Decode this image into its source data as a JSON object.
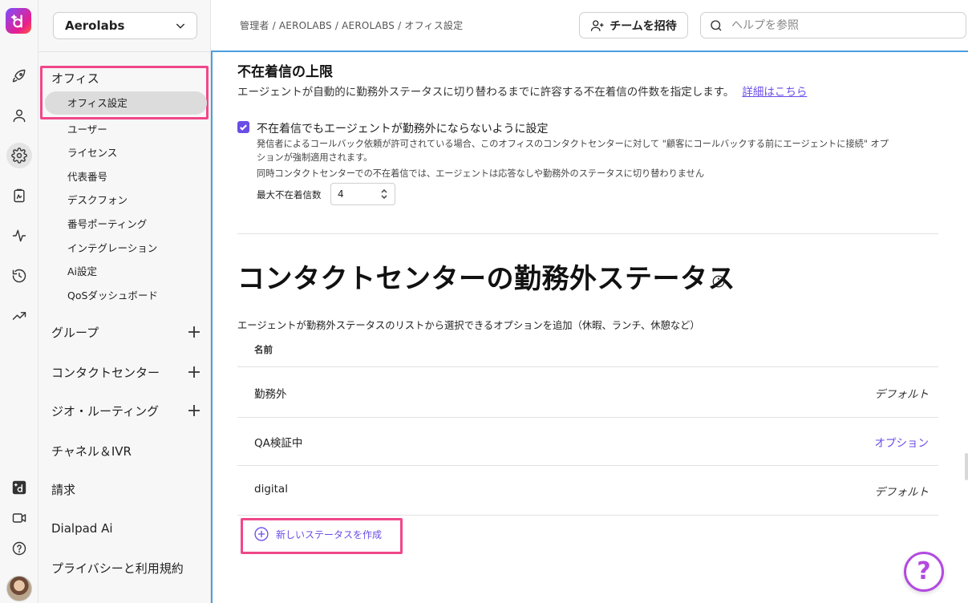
{
  "workspace": {
    "name": "Aerolabs"
  },
  "breadcrumb": "管理者 / AEROLABS / AEROLABS / オフィス設定",
  "topbar": {
    "invite_label": "チームを招待",
    "search_placeholder": "ヘルプを参照"
  },
  "sidebar": {
    "office_title": "オフィス",
    "office_items": [
      "オフィス設定",
      "ユーザー",
      "ライセンス",
      "代表番号",
      "デスクフォン",
      "番号ポーティング",
      "インテグレーション",
      "Ai設定",
      "QoSダッシュボード"
    ],
    "sections": [
      "グループ",
      "コンタクトセンター",
      "ジオ・ルーティング",
      "チャネル＆IVR",
      "請求",
      "Dialpad Ai",
      "プライバシーと利用規約"
    ]
  },
  "missed_calls": {
    "title": "不在着信の上限",
    "description": "エージェントが自動的に勤務外ステータスに切り替わるまでに許容する不在着信の件数を指定します。",
    "link": "詳細はこちら",
    "checkbox_label": "不在着信でもエージェントが勤務外にならないように設定",
    "checkbox_checked": true,
    "note_lines": [
      "発信者によるコールバック依頼が許可されている場合、このオフィスのコンタクトセンターに対して \"顧客にコールバックする前にエージェントに接続\" オプ",
      "ションが強制適用されます。",
      "同時コンタクトセンターでの不在着信では、エージェントは応答なしや勤務外のステータスに切り替わりません"
    ],
    "max_label": "最大不在着信数",
    "max_value": "4"
  },
  "status_section": {
    "title": "コンタクトセンターの勤務外ステータス",
    "description": "エージェントが勤務外ステータスのリストから選択できるオプションを追加（休暇、ランチ、休憩など）",
    "column_name": "名前",
    "rows": [
      {
        "name": "勤務外",
        "type": "デフォルト"
      },
      {
        "name": "QA検証中",
        "type": "オプション"
      },
      {
        "name": "digital",
        "type": "デフォルト"
      }
    ],
    "create_label": "新しいステータスを作成"
  },
  "icons": {
    "rail": [
      "rocket-icon",
      "person-icon",
      "gear-icon",
      "clipboard-icon",
      "activity-icon",
      "history-icon",
      "trending-icon",
      "dialpad-ai-icon",
      "video-icon",
      "help-icon"
    ]
  },
  "colors": {
    "accent": "#6b4de6",
    "highlight": "#f0478a",
    "focus_border": "#4a9fe0",
    "help_fab": "#b24ae0"
  }
}
